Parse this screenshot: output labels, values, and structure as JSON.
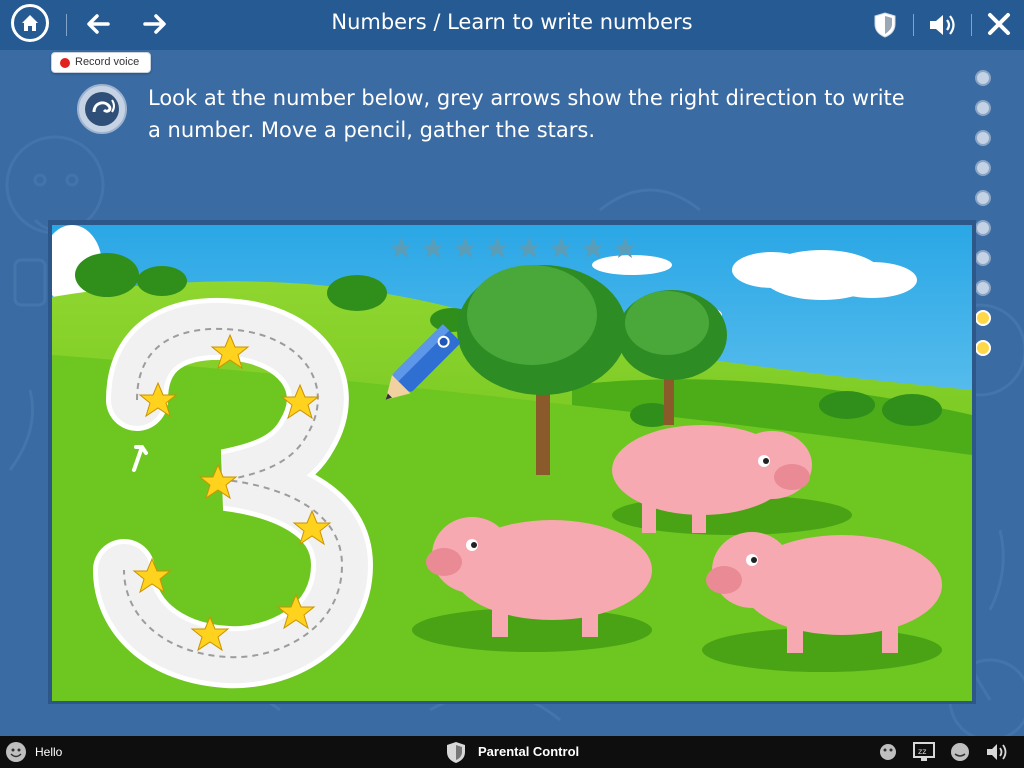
{
  "header": {
    "title": "Numbers / Learn to write numbers",
    "icons": {
      "home": "home-icon",
      "back": "arrow-left-icon",
      "forward": "arrow-right-icon",
      "shield": "shield-icon",
      "sound": "speaker-icon",
      "close": "close-icon"
    }
  },
  "record": {
    "label": "Record voice"
  },
  "instruction": {
    "line1": "Look at the number below, grey arrows show the right direction to write",
    "line2": "a number. Move a pencil, gather the stars."
  },
  "progress": {
    "total": 10,
    "completed_index": [
      8,
      9
    ]
  },
  "task": {
    "number": "3",
    "stars_total": 8,
    "stars_collected": 0
  },
  "footer": {
    "greeting": "Hello",
    "parental_control": "Parental Control"
  },
  "colors": {
    "header_bg": "#265a93",
    "page_bg": "#3a6ba3",
    "sky": "#5fc3ef",
    "grass": "#6fc81e",
    "pig": "#f6a9b1",
    "star": "#ffd21e",
    "progress_done": "#ffd84a"
  }
}
